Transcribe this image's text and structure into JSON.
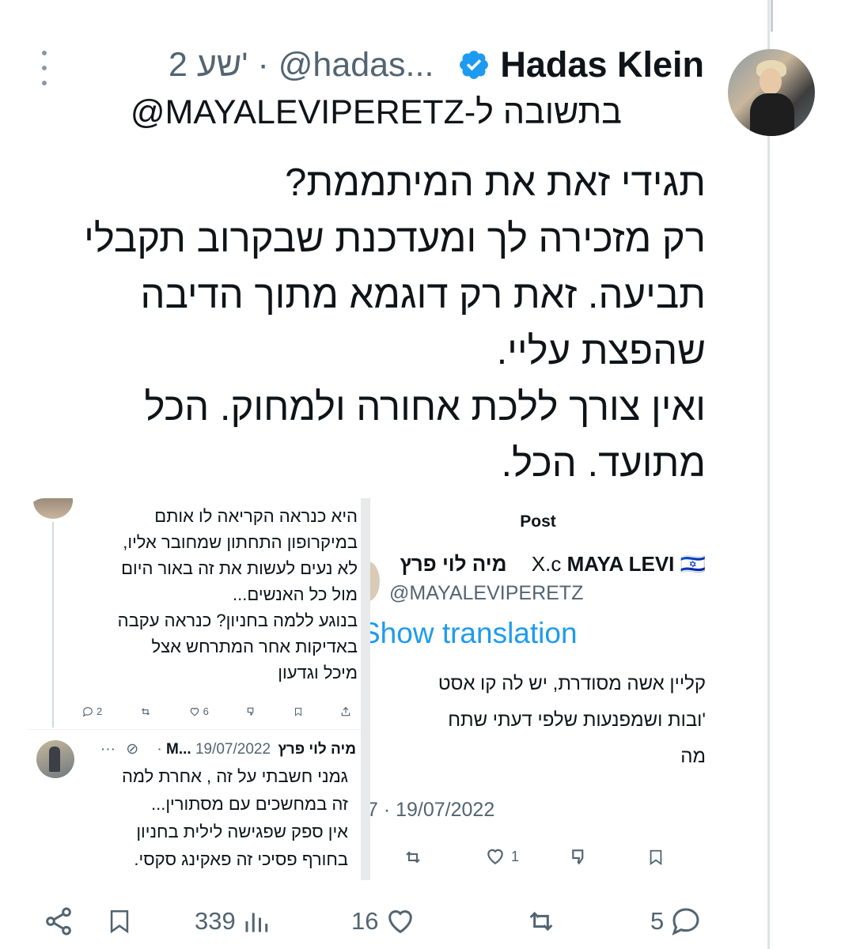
{
  "tweet": {
    "author_name": "Hadas Klein",
    "handle": "@hadas...",
    "time": "2 שע'",
    "separator": "·",
    "reply_prefix": "בתשובה ל-",
    "reply_to": "@MAYALEVIPERETZ",
    "text_lines": [
      "תגידי זאת את המיתממת?",
      "רק מזכירה לך ומעדכנת שבקרוב תקבלי",
      "תביעה. זאת רק דוגמא מתוך הדיבה",
      "שהפצת עליי.",
      "ואין צורך ללכת אחורה ולמחוק. הכל",
      "מתועד. הכל."
    ],
    "actions": {
      "replies": "5",
      "likes": "16",
      "views": "339"
    }
  },
  "embedded_right": {
    "header": "Post",
    "source": "X.c",
    "display_name": "MAYA LEVI 🇮🇱 מיה לוי פרץ",
    "handle": "@MAYALEVIPERETZ",
    "show_translation": "Show translation",
    "text_lines": [
      "קליין אשה מסודרת, יש לה קו אסט",
      "'ובות ושמפנעות שלפי דעתי שתח",
      "מה"
    ],
    "date": "7 · 19/07/2022",
    "likes": "1"
  },
  "embedded_left": {
    "top_lines": [
      "היא כנראה הקריאה לו אותם",
      "במיקרופון התחתון שמחובר אליו,",
      "לא נעים לעשות את זה באור היום",
      "מול כל האנשים...",
      "בנוגע ללמה בחניון? כנראה עקבה",
      "באדיקות אחר המתרחש אצל",
      "מיכל וגדעון"
    ],
    "top_actions": {
      "replies": "2",
      "likes": "6"
    },
    "second_author": "מיה לוי פרץ M...",
    "second_date": "19/07/2022 ·",
    "second_lines": [
      "גמני חשבתי על זה , אחרת למה",
      "זה במחשכים עם מסתורין...",
      "אין ספק שפגישה לילית בחניון",
      "בחורף פסיכי זה פאקינג סקסי."
    ]
  },
  "colors": {
    "verified": "#1d9bf0",
    "text": "#0f1419",
    "secondary": "#536471",
    "link": "#1d9bf0"
  }
}
